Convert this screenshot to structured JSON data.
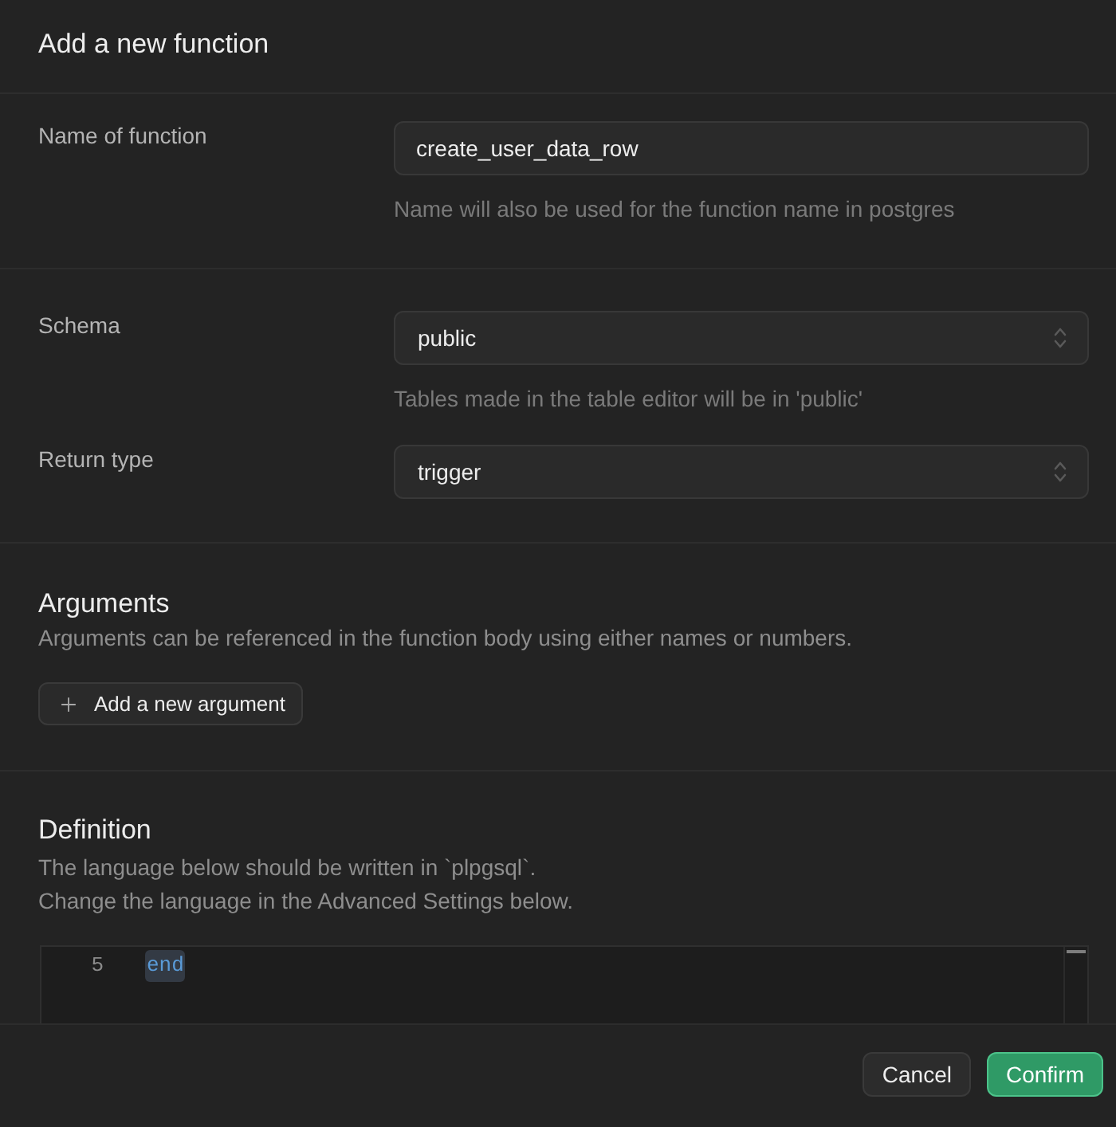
{
  "dialog": {
    "title": "Add a new function"
  },
  "sections": [
    {
      "fields": [
        {
          "kind": "text",
          "label": "Name of function",
          "value": "create_user_data_row",
          "hint": "Name will also be used for the function name in postgres"
        }
      ]
    },
    {
      "fields": [
        {
          "kind": "select",
          "label": "Schema",
          "value": "public",
          "hint": "Tables made in the table editor will be in 'public'"
        },
        {
          "kind": "select",
          "label": "Return type",
          "value": "trigger"
        }
      ]
    }
  ],
  "arguments": {
    "title": "Arguments",
    "description": "Arguments can be referenced in the function body using either names or numbers.",
    "add_button": "Add a new argument"
  },
  "definition": {
    "title": "Definition",
    "description": [
      "The language below should be written in `plpgsql`.",
      "Change the language in the Advanced Settings below."
    ],
    "editor": {
      "lines": [
        {
          "number": "5",
          "code": "end",
          "selected": true
        }
      ]
    }
  },
  "footer": {
    "buttons": [
      {
        "label": "Cancel",
        "kind": "secondary"
      },
      {
        "label": "Confirm",
        "kind": "primary"
      }
    ]
  }
}
